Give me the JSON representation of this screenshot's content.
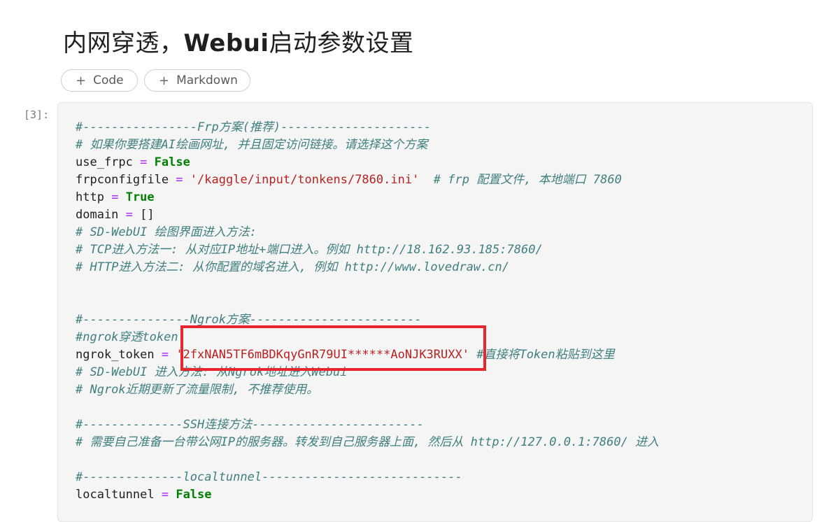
{
  "heading": {
    "prefix": "内网穿透，",
    "bold": "Webui",
    "suffix": "启动参数设置"
  },
  "toolbar": {
    "code_label": "Code",
    "markdown_label": "Markdown",
    "plus": "+"
  },
  "cell": {
    "prompt": "[3]:"
  },
  "code_lines": [
    [
      [
        "c",
        "#----------------Frp方案(推荐)---------------------"
      ]
    ],
    [
      [
        "c",
        "# 如果你要搭建AI绘画网址, 并且固定访问链接。请选择这个方案"
      ]
    ],
    [
      [
        "t",
        "use_frpc "
      ],
      [
        "o",
        "="
      ],
      [
        "t",
        " "
      ],
      [
        "k",
        "False"
      ]
    ],
    [
      [
        "t",
        "frpconfigfile "
      ],
      [
        "o",
        "="
      ],
      [
        "t",
        " "
      ],
      [
        "s",
        "'/kaggle/input/tonkens/7860.ini'"
      ],
      [
        "t",
        "  "
      ],
      [
        "c",
        "# frp 配置文件, 本地端口 7860"
      ]
    ],
    [
      [
        "t",
        "http "
      ],
      [
        "o",
        "="
      ],
      [
        "t",
        " "
      ],
      [
        "k",
        "True"
      ]
    ],
    [
      [
        "t",
        "domain "
      ],
      [
        "o",
        "="
      ],
      [
        "t",
        " []"
      ]
    ],
    [
      [
        "c",
        "# SD-WebUI 绘图界面进入方法:"
      ]
    ],
    [
      [
        "c",
        "# TCP进入方法一: 从对应IP地址+端口进入。例如 http://18.162.93.185:7860/"
      ]
    ],
    [
      [
        "c",
        "# HTTP进入方法二: 从你配置的域名进入, 例如 http://www.lovedraw.cn/"
      ]
    ],
    [],
    [],
    [
      [
        "c",
        "#---------------Ngrok方案------------------------"
      ]
    ],
    [
      [
        "c",
        "#ngrok穿透token"
      ]
    ],
    [
      [
        "t",
        "ngrok_token "
      ],
      [
        "o",
        "="
      ],
      [
        "t",
        " "
      ],
      [
        "s",
        "'2fxNAN5TF6mBDKqyGnR79UI******AoNJK3RUXX'"
      ],
      [
        "t",
        " "
      ],
      [
        "c",
        "#直接将Token粘贴到这里"
      ]
    ],
    [
      [
        "c",
        "# SD-WebUI 进入方法: 从Ngrok地址进入Webui"
      ]
    ],
    [
      [
        "c",
        "# Ngrok近期更新了流量限制, 不推荐使用。"
      ]
    ],
    [],
    [
      [
        "c",
        "#--------------SSH连接方法------------------------"
      ]
    ],
    [
      [
        "c",
        "# 需要自己准备一台带公网IP的服务器。转发到自己服务器上面, 然后从 http://127.0.0.1:7860/ 进入"
      ]
    ],
    [],
    [
      [
        "c",
        "#--------------localtunnel----------------------------"
      ]
    ],
    [
      [
        "t",
        "localtunnel "
      ],
      [
        "o",
        "="
      ],
      [
        "t",
        " "
      ],
      [
        "k",
        "False"
      ]
    ]
  ]
}
